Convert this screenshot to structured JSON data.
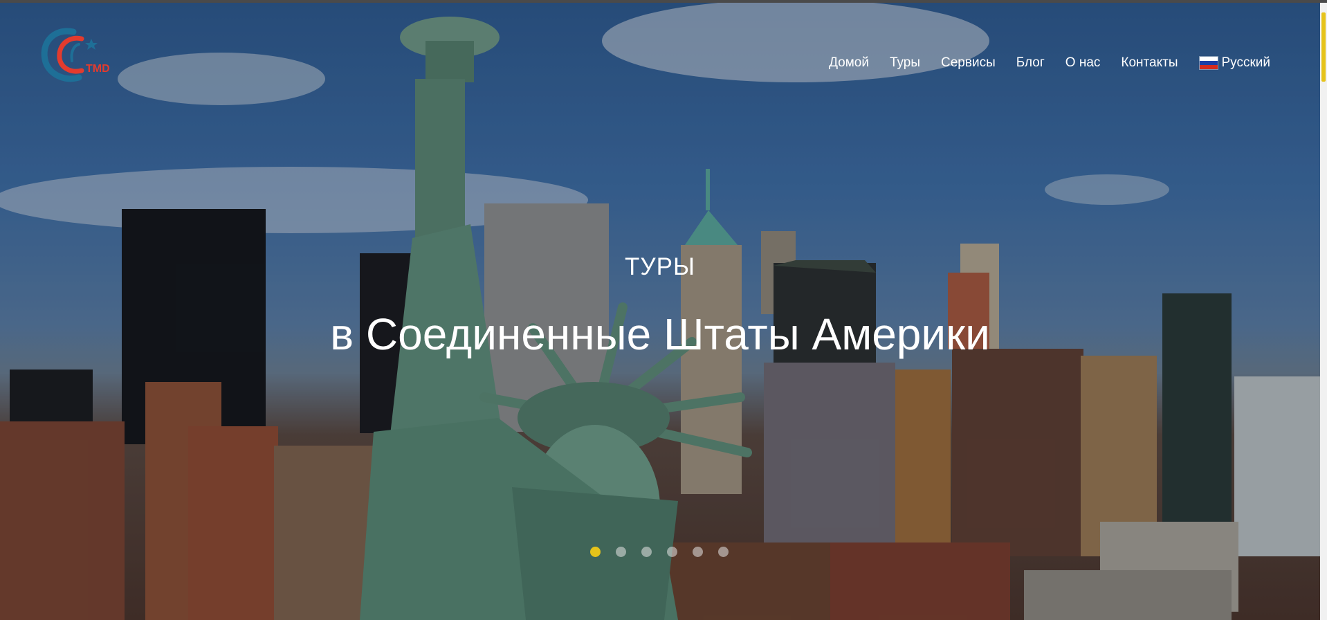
{
  "brand": {
    "logo_text": "TMD",
    "accent": "#e6c31a",
    "logo_blue": "#1e6f97",
    "logo_red": "#e33b2e"
  },
  "nav": {
    "items": [
      {
        "label": "Домой"
      },
      {
        "label": "Туры"
      },
      {
        "label": "Сервисы"
      },
      {
        "label": "Блог"
      },
      {
        "label": "О нас"
      },
      {
        "label": "Контакты"
      }
    ],
    "language": {
      "label": "Русский",
      "icon": "russia-flag-icon"
    }
  },
  "hero": {
    "kicker": "ТУРЫ",
    "headline": "в Соединенные Штаты Америки",
    "slides_count": 6,
    "active_slide": 1
  }
}
